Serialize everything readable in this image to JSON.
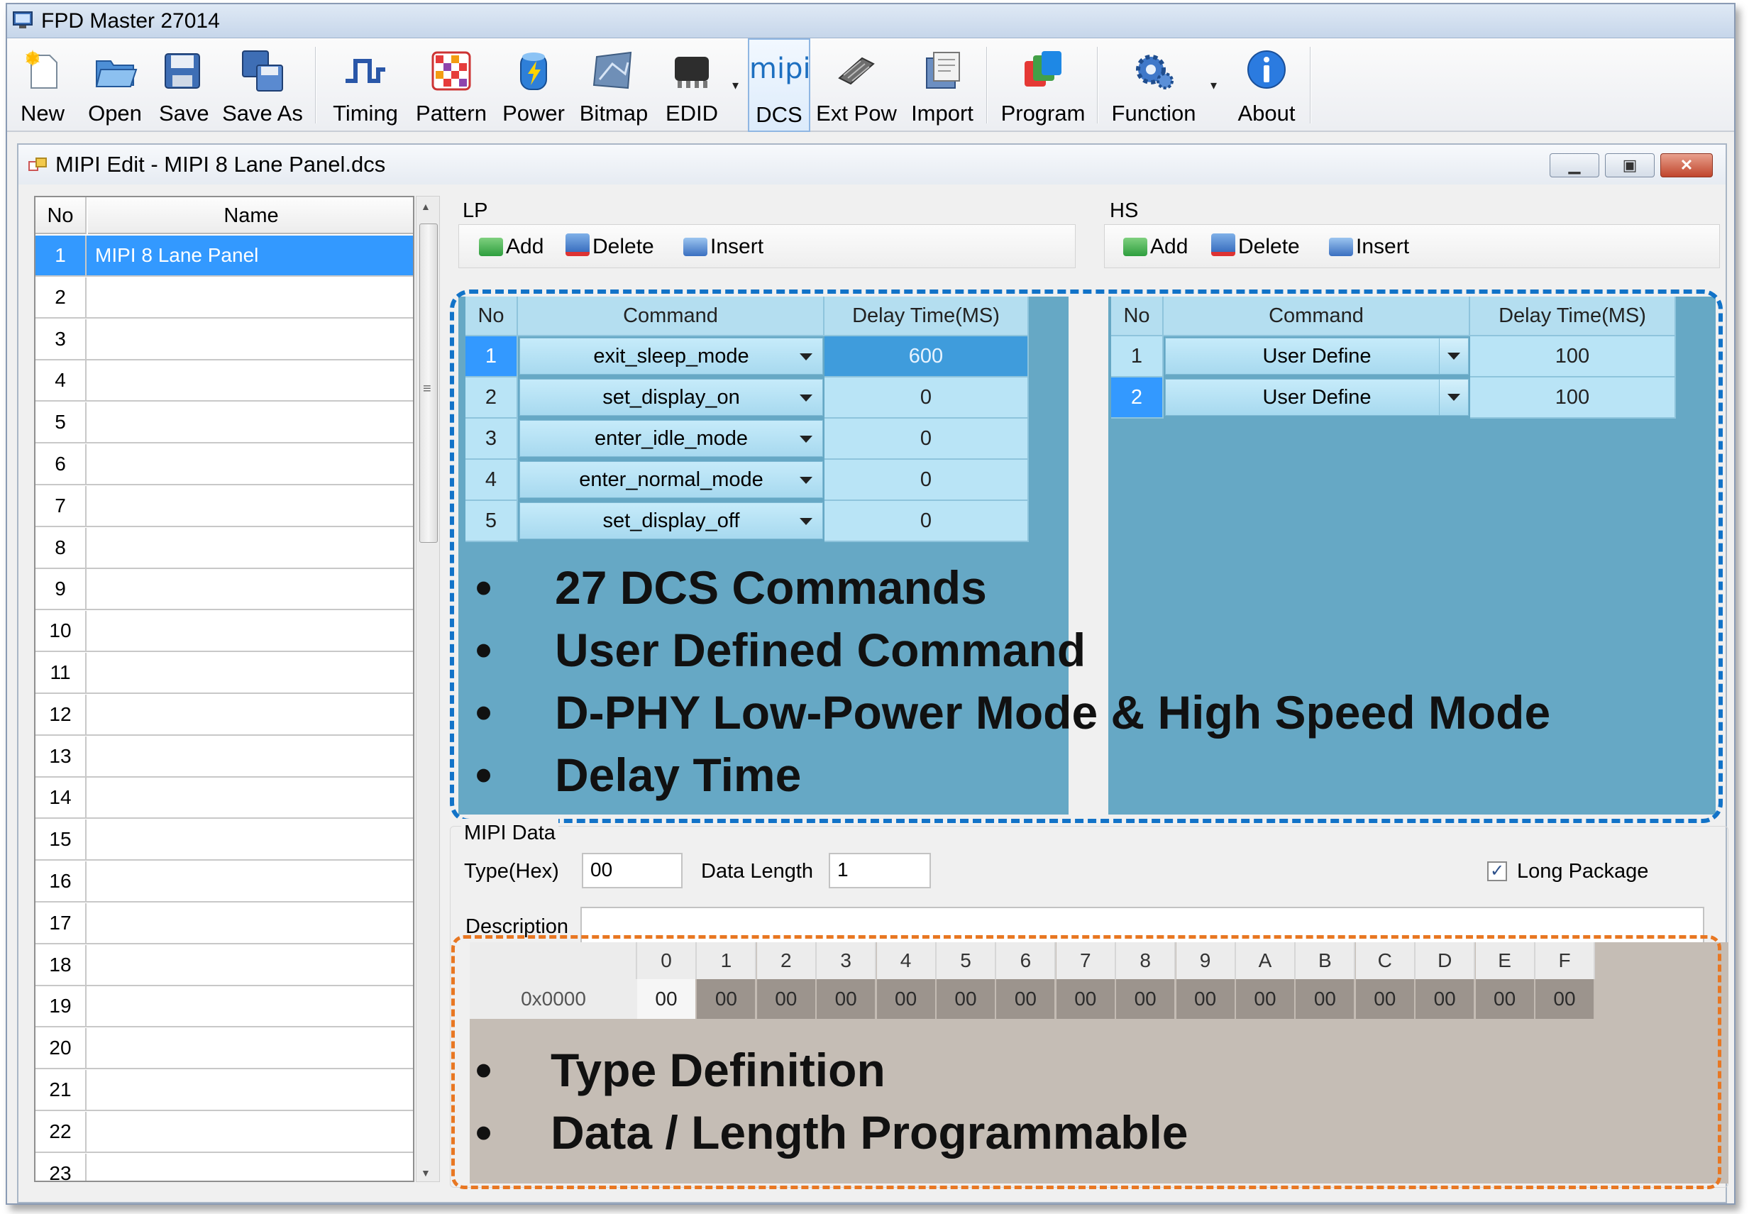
{
  "window": {
    "title": "FPD Master 27014"
  },
  "toolbar": {
    "buttons": [
      {
        "label": "New",
        "icon": "new-file-icon"
      },
      {
        "label": "Open",
        "icon": "open-folder-icon"
      },
      {
        "label": "Save",
        "icon": "floppy-disk-icon"
      },
      {
        "label": "Save As",
        "icon": "save-as-icon"
      },
      {
        "label": "Timing",
        "icon": "waveform-icon"
      },
      {
        "label": "Pattern",
        "icon": "color-pattern-icon"
      },
      {
        "label": "Power",
        "icon": "power-bolt-icon"
      },
      {
        "label": "Bitmap",
        "icon": "bitmap-icon"
      },
      {
        "label": "EDID",
        "icon": "chip-icon"
      },
      {
        "label": "DCS",
        "icon": "mipi-logo-icon",
        "logo_text": "mipi"
      },
      {
        "label": "Ext Pow",
        "icon": "ext-power-icon"
      },
      {
        "label": "Import",
        "icon": "import-icon"
      },
      {
        "label": "Program",
        "icon": "program-icon"
      },
      {
        "label": "Function",
        "icon": "gear-icon"
      },
      {
        "label": "About",
        "icon": "info-icon"
      }
    ]
  },
  "child": {
    "title": "MIPI Edit - MIPI 8 Lane Panel.dcs"
  },
  "panel_list": {
    "headers": {
      "no": "No",
      "name": "Name"
    },
    "rows": [
      {
        "no": "1",
        "name": "MIPI 8 Lane Panel"
      },
      {
        "no": "2",
        "name": ""
      },
      {
        "no": "3",
        "name": ""
      },
      {
        "no": "4",
        "name": ""
      },
      {
        "no": "5",
        "name": ""
      },
      {
        "no": "6",
        "name": ""
      },
      {
        "no": "7",
        "name": ""
      },
      {
        "no": "8",
        "name": ""
      },
      {
        "no": "9",
        "name": ""
      },
      {
        "no": "10",
        "name": ""
      },
      {
        "no": "11",
        "name": ""
      },
      {
        "no": "12",
        "name": ""
      },
      {
        "no": "13",
        "name": ""
      },
      {
        "no": "14",
        "name": ""
      },
      {
        "no": "15",
        "name": ""
      },
      {
        "no": "16",
        "name": ""
      },
      {
        "no": "17",
        "name": ""
      },
      {
        "no": "18",
        "name": ""
      },
      {
        "no": "19",
        "name": ""
      },
      {
        "no": "20",
        "name": ""
      },
      {
        "no": "21",
        "name": ""
      },
      {
        "no": "22",
        "name": ""
      },
      {
        "no": "23",
        "name": ""
      }
    ],
    "selected_row": "1"
  },
  "lp": {
    "label": "LP",
    "actions": {
      "add": "Add",
      "delete": "Delete",
      "insert": "Insert"
    },
    "headers": {
      "no": "No",
      "command": "Command",
      "delay": "Delay Time(MS)"
    },
    "rows": [
      {
        "no": "1",
        "command": "exit_sleep_mode",
        "delay": "600"
      },
      {
        "no": "2",
        "command": "set_display_on",
        "delay": "0"
      },
      {
        "no": "3",
        "command": "enter_idle_mode",
        "delay": "0"
      },
      {
        "no": "4",
        "command": "enter_normal_mode",
        "delay": "0"
      },
      {
        "no": "5",
        "command": "set_display_off",
        "delay": "0"
      }
    ]
  },
  "hs": {
    "label": "HS",
    "actions": {
      "add": "Add",
      "delete": "Delete",
      "insert": "Insert"
    },
    "headers": {
      "no": "No",
      "command": "Command",
      "delay": "Delay Time(MS)"
    },
    "rows": [
      {
        "no": "1",
        "command": "User Define",
        "delay": "100"
      },
      {
        "no": "2",
        "command": "User Define",
        "delay": "100"
      }
    ]
  },
  "callout_blue": {
    "bullets": [
      "27 DCS Commands",
      "User Defined Command",
      "D-PHY Low-Power Mode & High Speed Mode",
      "Delay Time"
    ]
  },
  "mipi_data": {
    "label": "MIPI Data",
    "type_label": "Type(Hex)",
    "type_value": "00",
    "length_label": "Data Length",
    "length_value": "1",
    "long_package_label": "Long Package",
    "long_package_checked": true,
    "description_label": "Description",
    "description_value": ""
  },
  "hex_grid": {
    "columns": [
      "0",
      "1",
      "2",
      "3",
      "4",
      "5",
      "6",
      "7",
      "8",
      "9",
      "A",
      "B",
      "C",
      "D",
      "E",
      "F"
    ],
    "address": "0x0000",
    "values": [
      "00",
      "00",
      "00",
      "00",
      "00",
      "00",
      "00",
      "00",
      "00",
      "00",
      "00",
      "00",
      "00",
      "00",
      "00",
      "00"
    ]
  },
  "callout_orange": {
    "bullets": [
      "Type Definition",
      "Data / Length Programmable"
    ]
  },
  "colors": {
    "accent_blue": "#1273c8",
    "accent_orange": "#e87722",
    "selection": "#3399ff",
    "grid_overlay": "#66a8c5",
    "hex_overlay": "#c5bdb5"
  }
}
